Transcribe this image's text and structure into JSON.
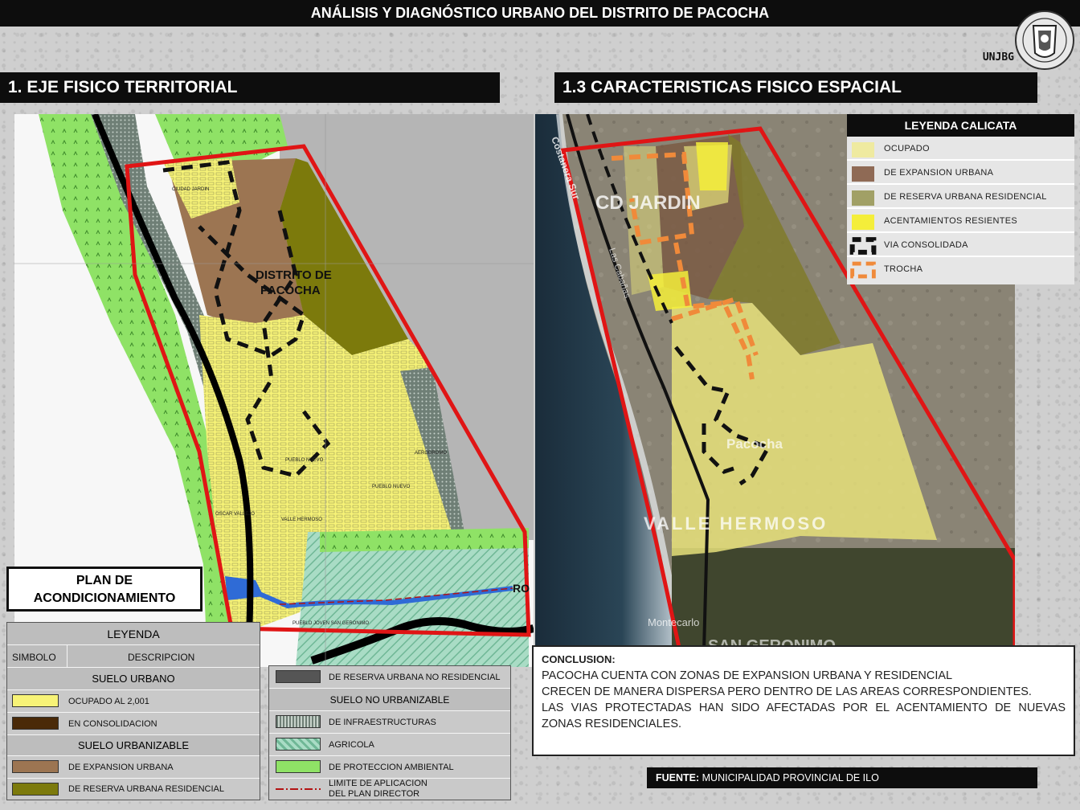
{
  "header": {
    "title": "ANÁLISIS Y DIAGNÓSTICO URBANO DEL DISTRITO DE PACOCHA"
  },
  "brand": {
    "unjbg": "UNJBG"
  },
  "sections": {
    "left_title": "1. EJE FISICO TERRITORIAL",
    "right_title": "1.3 CARACTERISTICAS FISICO ESPACIAL"
  },
  "left_map": {
    "district_label_1": "DISTRITO DE",
    "district_label_2": "PACOCHA",
    "place_labels": [
      "CIUDAD JARDIN",
      "PUEBLO NUEVO",
      "PUEBLO NUEVO",
      "AERODROMO",
      "VALLE HERMOSO",
      "OSCAR VALLEJO",
      "PUEBLO JOVEN SAN GERONIMO"
    ],
    "road_label": "RO",
    "plan_box": {
      "line1": "PLAN DE",
      "line2": "ACONDICIONAMIENTO"
    }
  },
  "right_map": {
    "place_labels": [
      "CD JARDIN",
      "Pacocha",
      "VALLE HERMOSO",
      "Montecarlo",
      "SAN GERONIMO",
      "Costanera Sur",
      "Las Cabañas"
    ]
  },
  "legend_left": {
    "title": "LEYENDA",
    "col_symbol": "SIMBOLO",
    "col_desc": "DESCRIPCION",
    "group_urbano": "SUELO URBANO",
    "ocupado": "OCUPADO AL 2,001",
    "consolidacion": "EN CONSOLIDACION",
    "group_urbanizable": "SUELO URBANIZABLE",
    "expansion": "DE EXPANSION URBANA",
    "reserva_res": "DE RESERVA URBANA RESIDENCIAL"
  },
  "legend_mid": {
    "reserva_no_res": "DE RESERVA URBANA NO RESIDENCIAL",
    "group_no_urbanizable": "SUELO NO URBANIZABLE",
    "infraestructuras": "DE INFRAESTRUCTURAS",
    "agricola": "AGRICOLA",
    "proteccion": "DE PROTECCION AMBIENTAL",
    "limite_1": "LIMITE DE APLICACION",
    "limite_2": "DEL PLAN DIRECTOR"
  },
  "legend_calicata": {
    "title": "LEYENDA  CALICATA",
    "items": [
      "OCUPADO",
      "DE EXPANSION URBANA",
      "DE RESERVA URBANA RESIDENCIAL",
      "ACENTAMIENTOS RESIENTES",
      "VIA CONSOLIDADA",
      "TROCHA"
    ]
  },
  "conclusion": {
    "heading": "CONCLUSION:",
    "p1": "PACOCHA CUENTA CON ZONAS DE EXPANSION URBANA Y RESIDENCIAL",
    "p2": " CRECEN DE MANERA DISPERSA PERO DENTRO DE LAS AREAS CORRESPONDIENTES.",
    "p3": " LAS VIAS PROTECTADAS HAN SIDO AFECTADAS POR EL ACENTAMIENTO DE NUEVAS ZONAS RESIDENCIALES."
  },
  "source": {
    "label": "FUENTE:",
    "text": " MUNICIPALIDAD PROVINCIAL DE ILO"
  },
  "colors": {
    "ocupado": "#f7f377",
    "expansion": "#9c7552",
    "reserva_residencial": "#7c7a0c",
    "consolidacion": "#4a2a08",
    "proteccion": "#8fe266",
    "boundary": "#e01515",
    "agricola": "#8fcfb0",
    "reserva_no_res": "#555555"
  }
}
